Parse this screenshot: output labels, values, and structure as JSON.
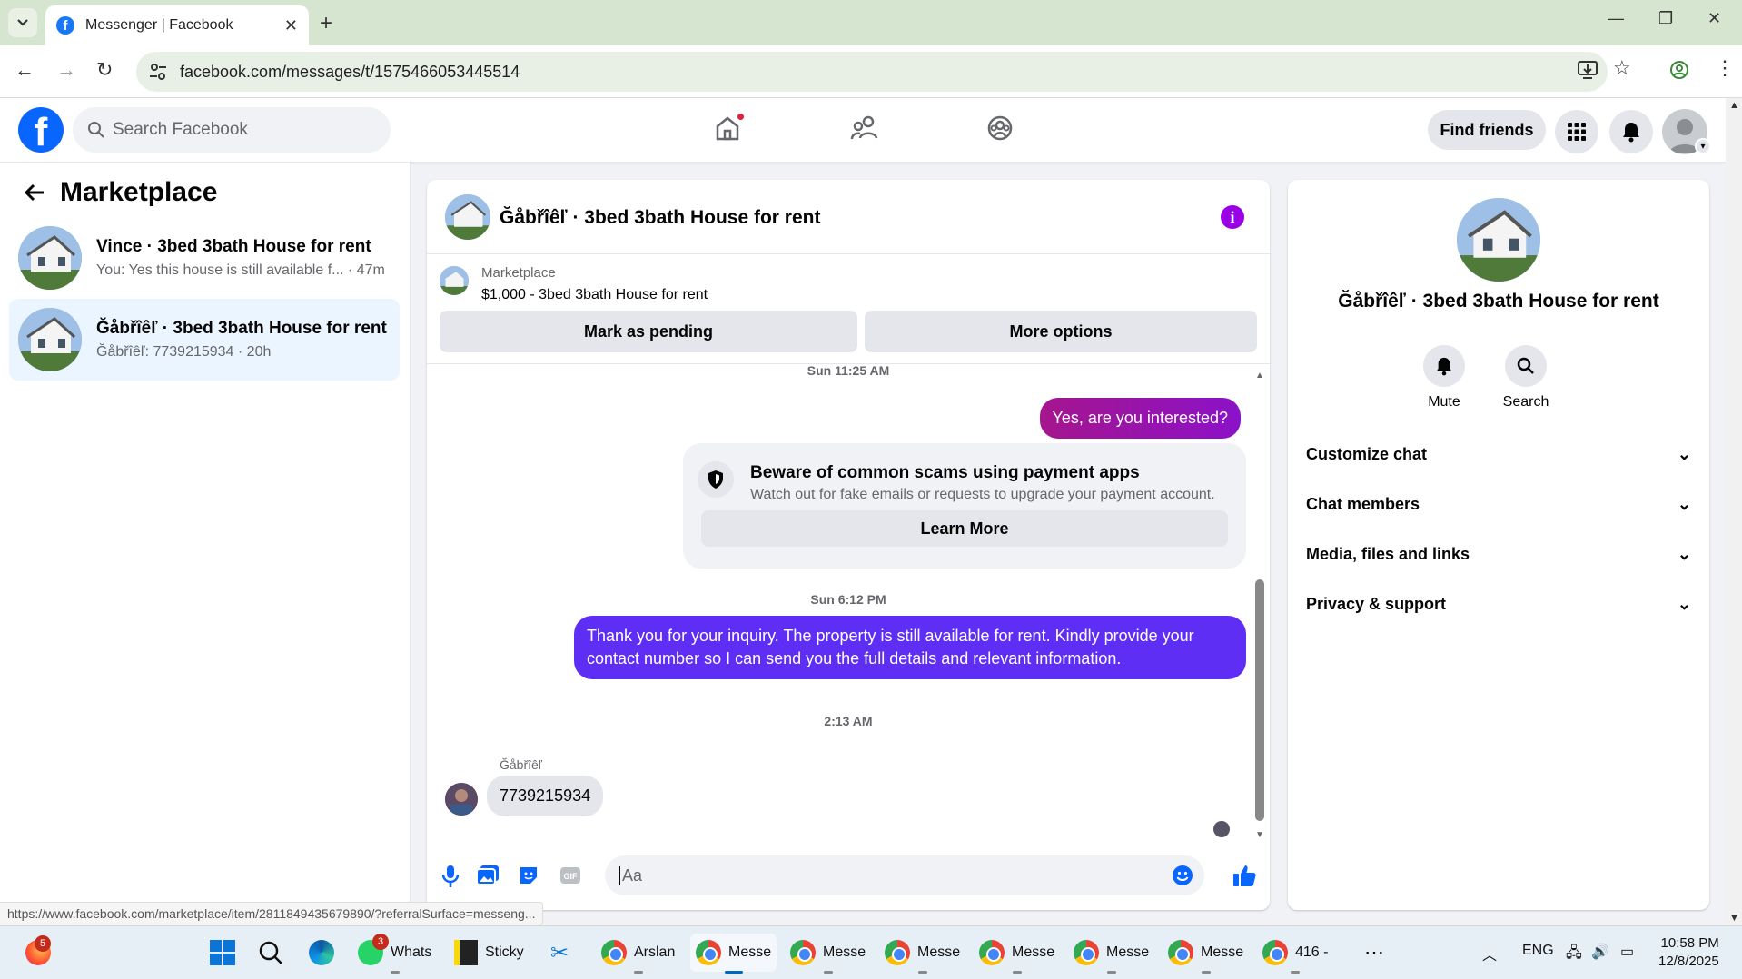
{
  "browser": {
    "tab_title": "Messenger | Facebook",
    "url": "facebook.com/messages/t/1575466053445514",
    "status_url": "https://www.facebook.com/marketplace/item/2811849435679890/?referralSurface=messeng..."
  },
  "fb_header": {
    "search_placeholder": "Search Facebook",
    "find_friends": "Find friends"
  },
  "sidebar": {
    "title": "Marketplace",
    "conversations": [
      {
        "name": "Vince · 3bed 3bath House for rent",
        "preview": "You: Yes this house is still available f... · 47m"
      },
      {
        "name": "Ğåbřîêľ · 3bed 3bath House for rent",
        "preview": "Ğåbřîêľ: 7739215934 · 20h"
      }
    ]
  },
  "chat": {
    "title": "Ğåbřîêľ · 3bed 3bath House for rent",
    "listing_label": "Marketplace",
    "listing_title": "$1,000 - 3bed 3bath House for rent",
    "mark_pending": "Mark as pending",
    "more_options": "More options",
    "ts1": "Sun 11:25 AM",
    "msg1": "Yes, are you interested?",
    "scam_title": "Beware of common scams using payment apps",
    "scam_body": "Watch out for fake emails or requests to upgrade your payment account.",
    "learn_more": "Learn More",
    "ts2": "Sun 6:12 PM",
    "msg2": "Thank you for your inquiry. The property is still available for rent. Kindly provide your contact number so I can send you the full details and relevant information.",
    "ts3": "2:13 AM",
    "sender": "Ğåbřîêľ",
    "msg3": "7739215934",
    "composer_placeholder": "Aa"
  },
  "details": {
    "name": "Ğåbřîêľ · 3bed 3bath House for rent",
    "mute": "Mute",
    "search": "Search",
    "sections": [
      "Customize chat",
      "Chat members",
      "Media, files and links",
      "Privacy & support"
    ]
  },
  "taskbar": {
    "firefox_badge": "5",
    "whatsapp_badge": "3",
    "items": [
      "Whats",
      "Sticky",
      "Arslan",
      "Messe",
      "Messe",
      "Messe",
      "Messe",
      "Messe",
      "Messe",
      "416 -"
    ],
    "lang": "ENG",
    "time": "10:58 PM",
    "date": "12/8/2025"
  },
  "colors": {
    "accent": "#5f2ef5",
    "fb_blue": "#0866ff",
    "info_purple": "#9900e6"
  }
}
